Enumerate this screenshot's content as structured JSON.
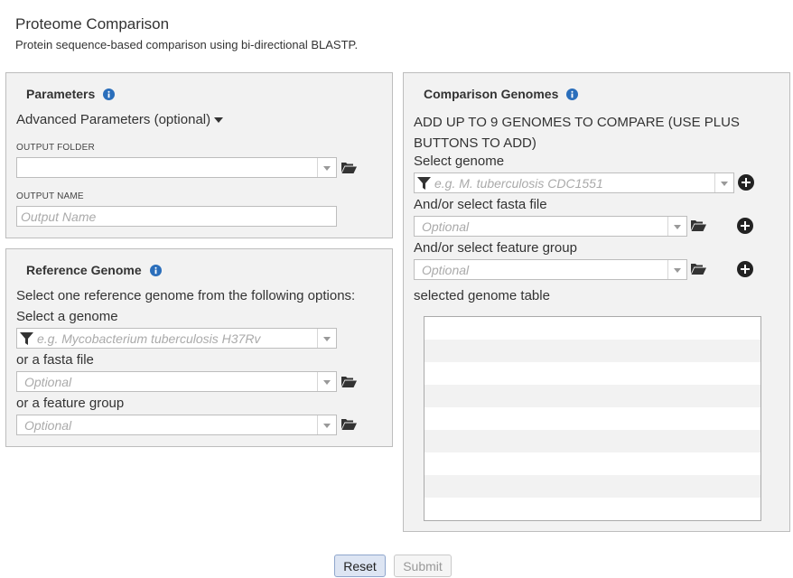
{
  "header": {
    "title": "Proteome Comparison",
    "subtitle": "Protein sequence-based comparison using bi-directional BLASTP."
  },
  "parameters": {
    "title": "Parameters",
    "advanced_label": "Advanced Parameters (optional)",
    "output_folder_label": "OUTPUT FOLDER",
    "output_folder_value": "",
    "output_name_label": "OUTPUT NAME",
    "output_name_placeholder": "Output Name"
  },
  "reference": {
    "title": "Reference Genome",
    "instructions": "Select one reference genome from the following options:",
    "select_genome_label": "Select a genome",
    "select_genome_placeholder": "e.g. Mycobacterium tuberculosis H37Rv",
    "fasta_label": "or a fasta file",
    "fasta_placeholder": "Optional",
    "feature_group_label": "or a feature group",
    "feature_group_placeholder": "Optional"
  },
  "comparison": {
    "title": "Comparison Genomes",
    "instructions": "ADD UP TO 9 GENOMES TO COMPARE (USE PLUS BUTTONS TO ADD)",
    "select_genome_label": "Select genome",
    "select_genome_placeholder": "e.g. M. tuberculosis CDC1551",
    "fasta_label": "And/or select fasta file",
    "fasta_placeholder": "Optional",
    "feature_group_label": "And/or select feature group",
    "feature_group_placeholder": "Optional",
    "table_label": "selected genome table",
    "table_rows": 9
  },
  "actions": {
    "reset_label": "Reset",
    "submit_label": "Submit"
  },
  "icons": {
    "info": "info-icon",
    "folder": "folder-open-icon",
    "plus": "plus-circle-icon",
    "filter": "filter-icon",
    "caret": "caret-down-icon"
  },
  "colors": {
    "icon_blue": "#2a6ebb",
    "panel_bg": "#f2f2f2",
    "reset_bg": "#dde5f3"
  }
}
